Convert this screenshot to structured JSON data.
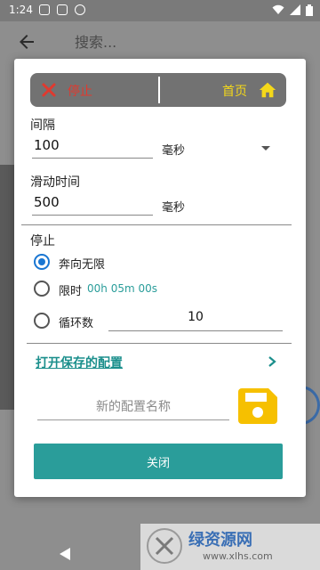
{
  "status_bar": {
    "time": "1:24"
  },
  "search": {
    "placeholder": "搜索..."
  },
  "control_bar": {
    "stop_label": "停止",
    "home_label": "首页"
  },
  "interval": {
    "label": "间隔",
    "value": "100",
    "unit": "毫秒"
  },
  "swipe_time": {
    "label": "滑动时间",
    "value": "500",
    "unit": "毫秒"
  },
  "stop_section": {
    "title": "停止",
    "options": [
      {
        "label": "奔向无限",
        "checked": true
      },
      {
        "label": "限时",
        "value": "00h 05m 00s",
        "checked": false
      },
      {
        "label": "循环数",
        "value": "10",
        "checked": false
      }
    ]
  },
  "open_saved_config": {
    "label": "打开保存的配置"
  },
  "config_name": {
    "placeholder": "新的配置名称"
  },
  "close_button": {
    "label": "关闭"
  },
  "watermark": {
    "main": "绿资源网",
    "sub": "www.xlhs.com"
  },
  "colors": {
    "accent": "#2a9d9a",
    "radio_blue": "#1976d2",
    "stop_red": "#e0392f",
    "home_yellow": "#f4d81a",
    "save_yellow": "#f6c000"
  },
  "icons": [
    "back-arrow-icon",
    "stop-x-icon",
    "home-icon",
    "dropdown-arrow-icon",
    "chevron-right-icon",
    "save-icon",
    "nav-back-icon"
  ]
}
